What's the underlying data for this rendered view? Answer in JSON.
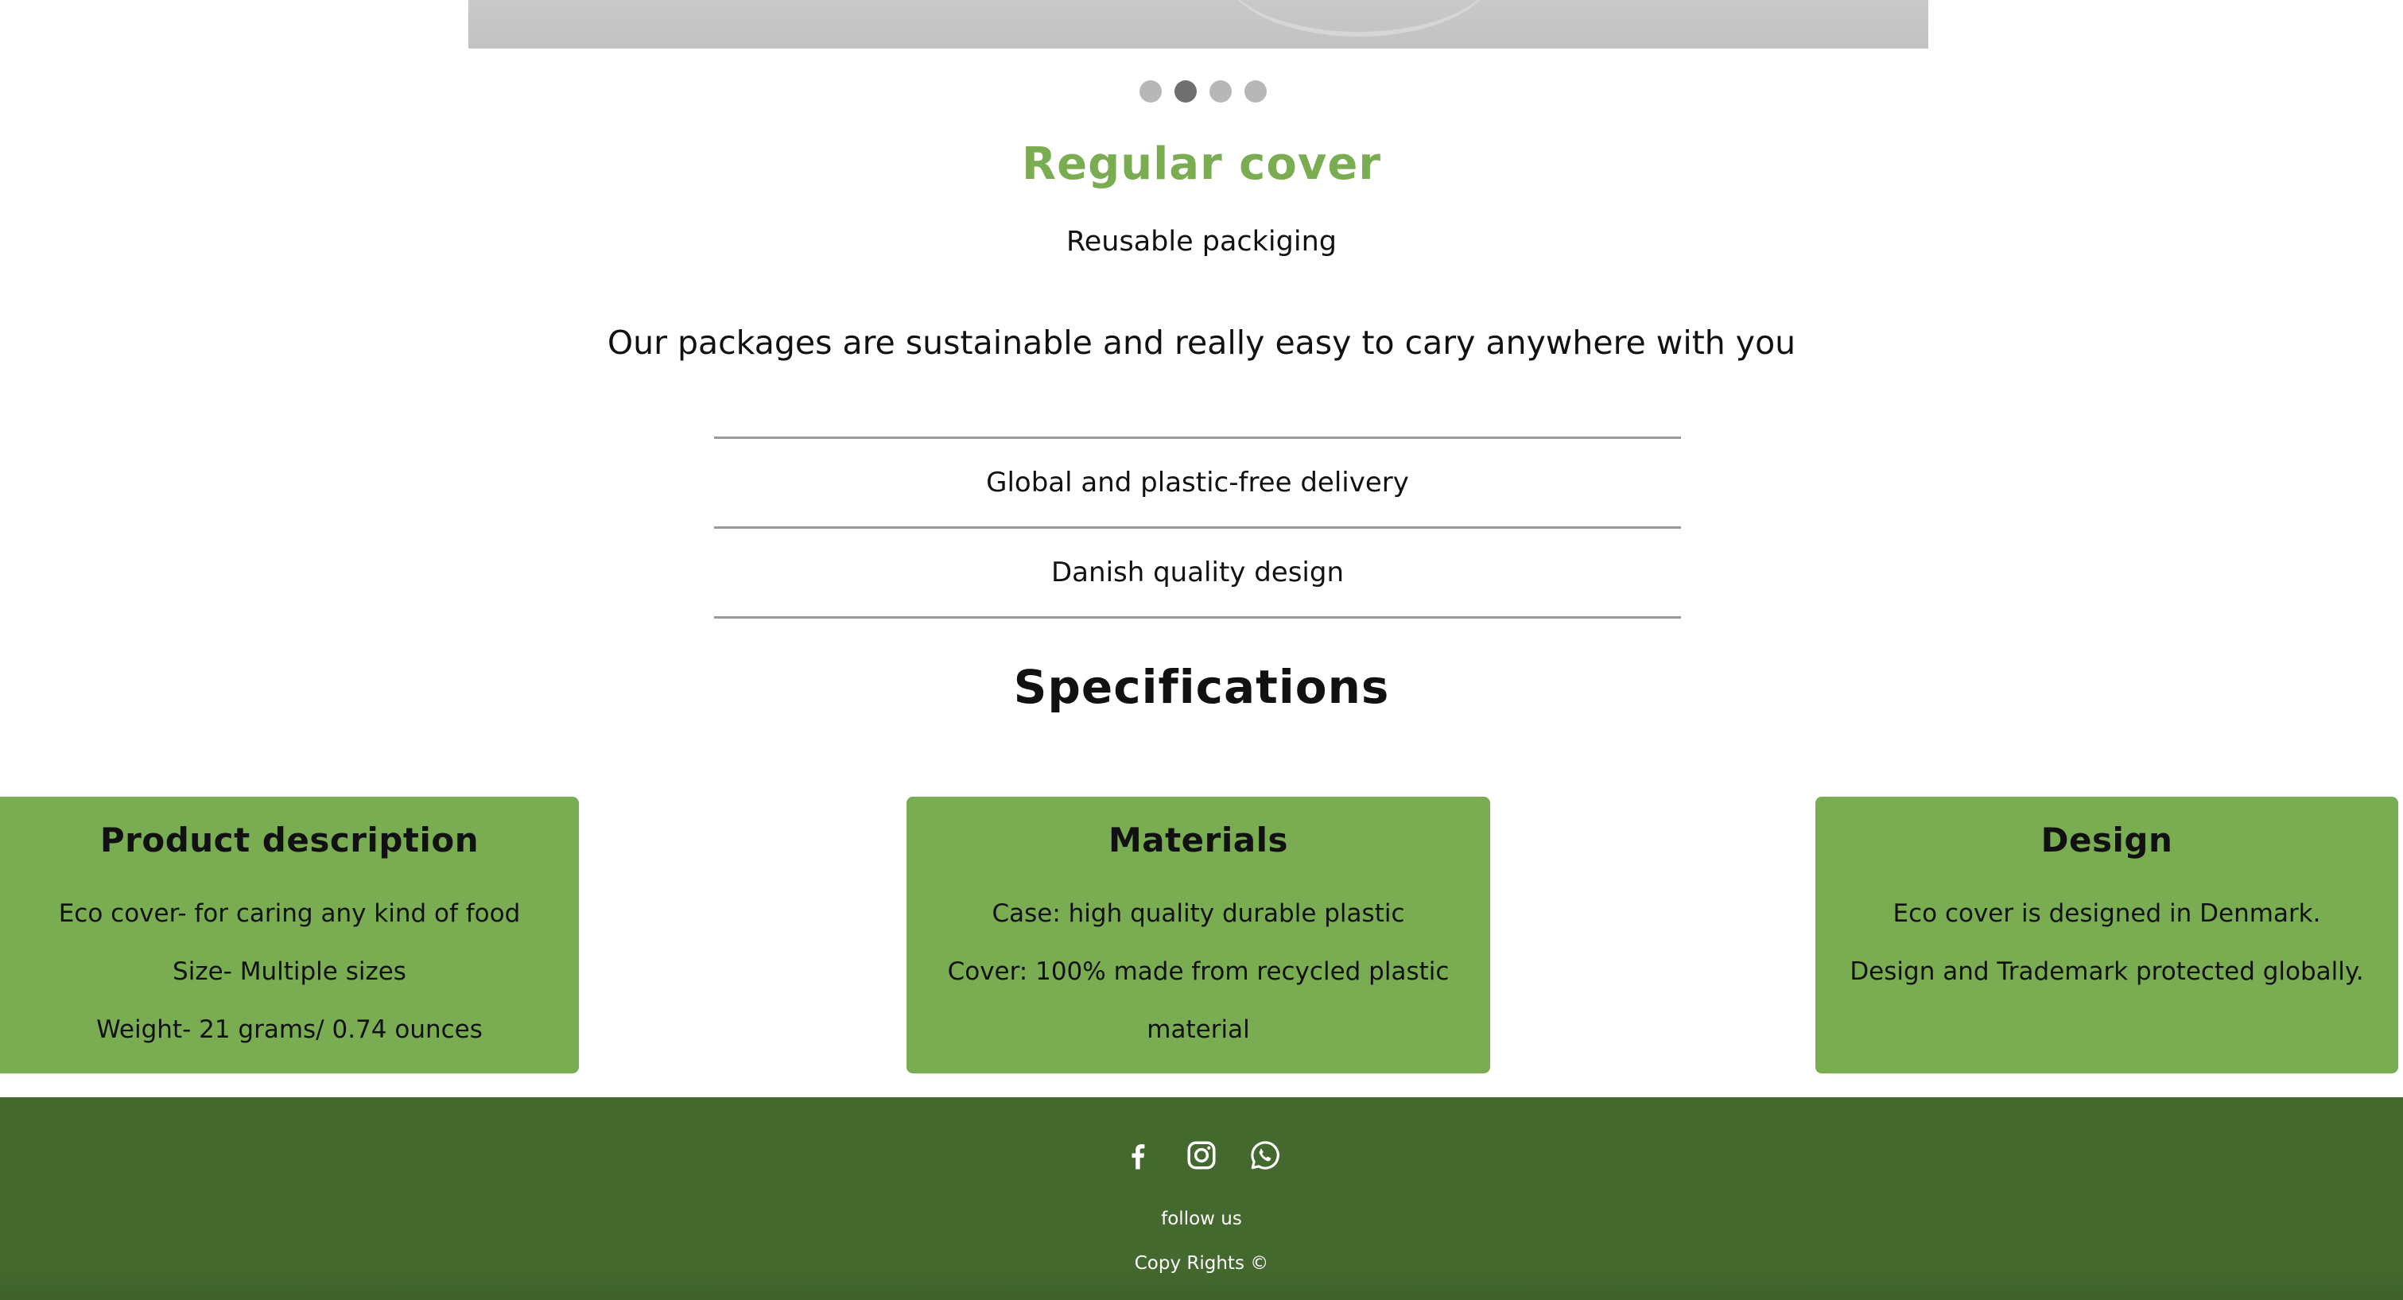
{
  "carousel": {
    "slide_count": 4,
    "active_index": 1
  },
  "product": {
    "title": "Regular cover",
    "subtitle": "Reusable packiging",
    "tagline": "Our packages are sustainable and really easy to cary anywhere with you"
  },
  "features": [
    "Global and plastic-free delivery",
    "Danish quality design"
  ],
  "specifications": {
    "title": "Specifications",
    "cards": [
      {
        "title": "Product description",
        "lines": [
          "Eco cover- for caring any kind of food",
          "Size- Multiple sizes",
          "Weight- 21 grams/ 0.74 ounces"
        ]
      },
      {
        "title": "Materials",
        "lines": [
          "Case: high quality durable plastic",
          "Cover: 100% made from recycled plastic material"
        ]
      },
      {
        "title": "Design",
        "lines": [
          "Eco cover is designed in Denmark.",
          "Design and Trademark protected globally."
        ]
      }
    ]
  },
  "footer": {
    "social_icons": [
      "facebook-icon",
      "instagram-icon",
      "whatsapp-icon"
    ],
    "follow_text": "follow us",
    "copyright": "Copy Rights ©"
  },
  "colors": {
    "accent_green": "#7aad52",
    "footer_green": "#44692e",
    "dot_inactive": "#b7b7b7",
    "dot_active": "#6f6f6f"
  }
}
